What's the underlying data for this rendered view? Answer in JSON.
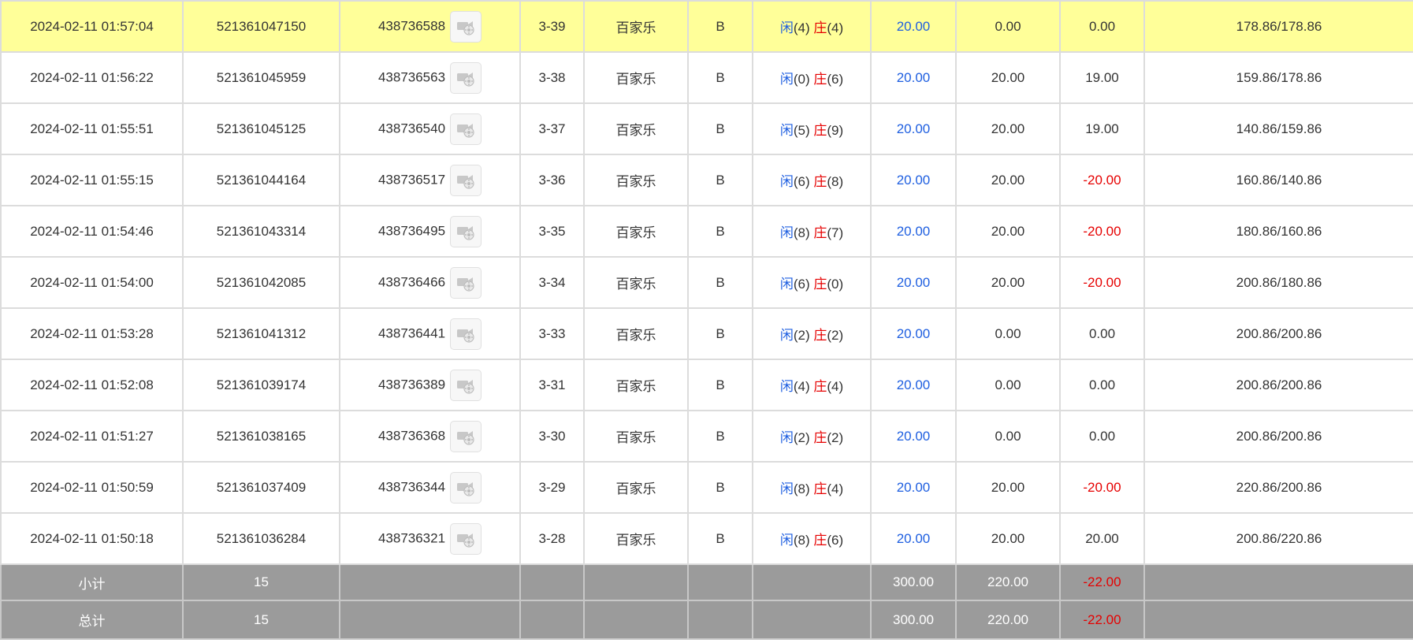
{
  "rows": [
    {
      "time": "2024-02-11 01:57:04",
      "order_no": "521361047150",
      "round_no": "438736588",
      "shoe": "3-39",
      "game": "百家乐",
      "table": "B",
      "player_label": "闲",
      "player_pts": "(4)",
      "banker_label": "庄",
      "banker_pts": "(4)",
      "bet": "20.00",
      "valid": "0.00",
      "win": "0.00",
      "win_negative": false,
      "balance": "178.86/178.86",
      "highlight": true
    },
    {
      "time": "2024-02-11 01:56:22",
      "order_no": "521361045959",
      "round_no": "438736563",
      "shoe": "3-38",
      "game": "百家乐",
      "table": "B",
      "player_label": "闲",
      "player_pts": "(0)",
      "banker_label": "庄",
      "banker_pts": "(6)",
      "bet": "20.00",
      "valid": "20.00",
      "win": "19.00",
      "win_negative": false,
      "balance": "159.86/178.86",
      "highlight": false
    },
    {
      "time": "2024-02-11 01:55:51",
      "order_no": "521361045125",
      "round_no": "438736540",
      "shoe": "3-37",
      "game": "百家乐",
      "table": "B",
      "player_label": "闲",
      "player_pts": "(5)",
      "banker_label": "庄",
      "banker_pts": "(9)",
      "bet": "20.00",
      "valid": "20.00",
      "win": "19.00",
      "win_negative": false,
      "balance": "140.86/159.86",
      "highlight": false
    },
    {
      "time": "2024-02-11 01:55:15",
      "order_no": "521361044164",
      "round_no": "438736517",
      "shoe": "3-36",
      "game": "百家乐",
      "table": "B",
      "player_label": "闲",
      "player_pts": "(6)",
      "banker_label": "庄",
      "banker_pts": "(8)",
      "bet": "20.00",
      "valid": "20.00",
      "win": "-20.00",
      "win_negative": true,
      "balance": "160.86/140.86",
      "highlight": false
    },
    {
      "time": "2024-02-11 01:54:46",
      "order_no": "521361043314",
      "round_no": "438736495",
      "shoe": "3-35",
      "game": "百家乐",
      "table": "B",
      "player_label": "闲",
      "player_pts": "(8)",
      "banker_label": "庄",
      "banker_pts": "(7)",
      "bet": "20.00",
      "valid": "20.00",
      "win": "-20.00",
      "win_negative": true,
      "balance": "180.86/160.86",
      "highlight": false
    },
    {
      "time": "2024-02-11 01:54:00",
      "order_no": "521361042085",
      "round_no": "438736466",
      "shoe": "3-34",
      "game": "百家乐",
      "table": "B",
      "player_label": "闲",
      "player_pts": "(6)",
      "banker_label": "庄",
      "banker_pts": "(0)",
      "bet": "20.00",
      "valid": "20.00",
      "win": "-20.00",
      "win_negative": true,
      "balance": "200.86/180.86",
      "highlight": false
    },
    {
      "time": "2024-02-11 01:53:28",
      "order_no": "521361041312",
      "round_no": "438736441",
      "shoe": "3-33",
      "game": "百家乐",
      "table": "B",
      "player_label": "闲",
      "player_pts": "(2)",
      "banker_label": "庄",
      "banker_pts": "(2)",
      "bet": "20.00",
      "valid": "0.00",
      "win": "0.00",
      "win_negative": false,
      "balance": "200.86/200.86",
      "highlight": false
    },
    {
      "time": "2024-02-11 01:52:08",
      "order_no": "521361039174",
      "round_no": "438736389",
      "shoe": "3-31",
      "game": "百家乐",
      "table": "B",
      "player_label": "闲",
      "player_pts": "(4)",
      "banker_label": "庄",
      "banker_pts": "(4)",
      "bet": "20.00",
      "valid": "0.00",
      "win": "0.00",
      "win_negative": false,
      "balance": "200.86/200.86",
      "highlight": false
    },
    {
      "time": "2024-02-11 01:51:27",
      "order_no": "521361038165",
      "round_no": "438736368",
      "shoe": "3-30",
      "game": "百家乐",
      "table": "B",
      "player_label": "闲",
      "player_pts": "(2)",
      "banker_label": "庄",
      "banker_pts": "(2)",
      "bet": "20.00",
      "valid": "0.00",
      "win": "0.00",
      "win_negative": false,
      "balance": "200.86/200.86",
      "highlight": false
    },
    {
      "time": "2024-02-11 01:50:59",
      "order_no": "521361037409",
      "round_no": "438736344",
      "shoe": "3-29",
      "game": "百家乐",
      "table": "B",
      "player_label": "闲",
      "player_pts": "(8)",
      "banker_label": "庄",
      "banker_pts": "(4)",
      "bet": "20.00",
      "valid": "20.00",
      "win": "-20.00",
      "win_negative": true,
      "balance": "220.86/200.86",
      "highlight": false
    },
    {
      "time": "2024-02-11 01:50:18",
      "order_no": "521361036284",
      "round_no": "438736321",
      "shoe": "3-28",
      "game": "百家乐",
      "table": "B",
      "player_label": "闲",
      "player_pts": "(8)",
      "banker_label": "庄",
      "banker_pts": "(6)",
      "bet": "20.00",
      "valid": "20.00",
      "win": "20.00",
      "win_negative": false,
      "balance": "200.86/220.86",
      "highlight": false
    }
  ],
  "subtotal": {
    "label": "小计",
    "count": "15",
    "bet": "300.00",
    "valid": "220.00",
    "win": "-22.00"
  },
  "total": {
    "label": "总计",
    "count": "15",
    "bet": "300.00",
    "valid": "220.00",
    "win": "-22.00"
  },
  "icons": {
    "video": "video-camera-icon"
  },
  "colors": {
    "highlight": "#ffff99",
    "player": "#1f5fe0",
    "banker": "#e60000",
    "negative": "#e60000",
    "summary_bg": "#9b9b9b"
  }
}
